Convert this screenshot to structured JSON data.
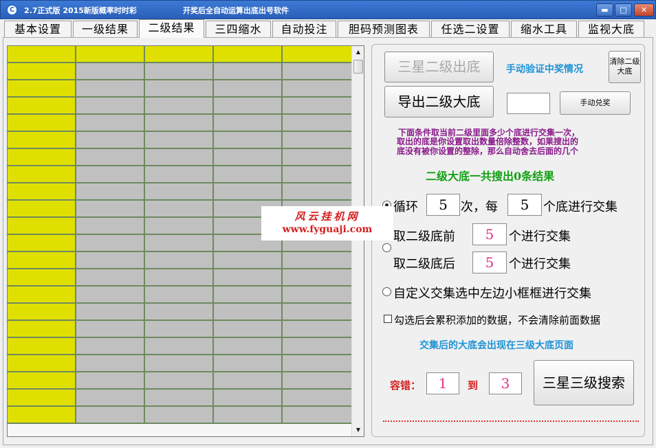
{
  "window": {
    "title": "2.7正式版 2015新版概率时时彩",
    "subtitle": "开奖后全自动运算出底出号软件",
    "icon_letter": "C",
    "min_glyph": "▬",
    "max_glyph": "□",
    "close_glyph": "✕"
  },
  "tabs": [
    {
      "label": "基本设置"
    },
    {
      "label": "一级结果"
    },
    {
      "label": "二级结果"
    },
    {
      "label": "三四缩水"
    },
    {
      "label": "自动投注"
    },
    {
      "label": "胆码预测图表"
    },
    {
      "label": "任选二设置"
    },
    {
      "label": "缩水工具"
    },
    {
      "label": "监视大底"
    }
  ],
  "active_tab": "二级结果",
  "grid": {
    "columns": 5,
    "rows": 22,
    "scroll_up": "▲",
    "scroll_down": "▼",
    "colors": {
      "highlight": "#e0e000",
      "cell": "#c0c0c0",
      "gridline": "#6d8a5e"
    }
  },
  "watermark": {
    "line1": "风云挂机网",
    "line2": "www.fyguaji.com"
  },
  "panel": {
    "btn_sanxing_chudi": "三星二级出底",
    "btn_export": "导出二级大底",
    "verify_label": "手动验证中奖情况",
    "btn_clear": "清除二级大底",
    "manual_value": "",
    "btn_manual": "手动兑奖",
    "desc_line1": "下面条件取当前二级里面多少个底进行交集一次，",
    "desc_line2": "取出的底是你设置取出数量倍除整数，如果搜出的",
    "desc_line3": "底没有被你设置的整除，那么自动舍去后面的几个",
    "total_result": "二级大底一共搜出0条结果",
    "opt_loop": {
      "label1": "循环",
      "value1": "5",
      "label2": "次，每",
      "value2": "5",
      "label3": "个底进行交集"
    },
    "opt_front": {
      "label1": "取二级底前",
      "value": "5",
      "label2": "个进行交集"
    },
    "opt_back": {
      "label1": "取二级底后",
      "value": "5",
      "label2": "个进行交集"
    },
    "opt_custom": "自定义交集选中左边小框框进行交集",
    "check_accumulate": "勾选后会累积添加的数据，不会清除前面数据",
    "result_note": "交集后的大底会出现在三级大底页面",
    "tolerance_label": "容错：",
    "tolerance_from": "1",
    "to_label": "到",
    "tolerance_to": "3",
    "btn_search3": "三星三级搜索"
  }
}
